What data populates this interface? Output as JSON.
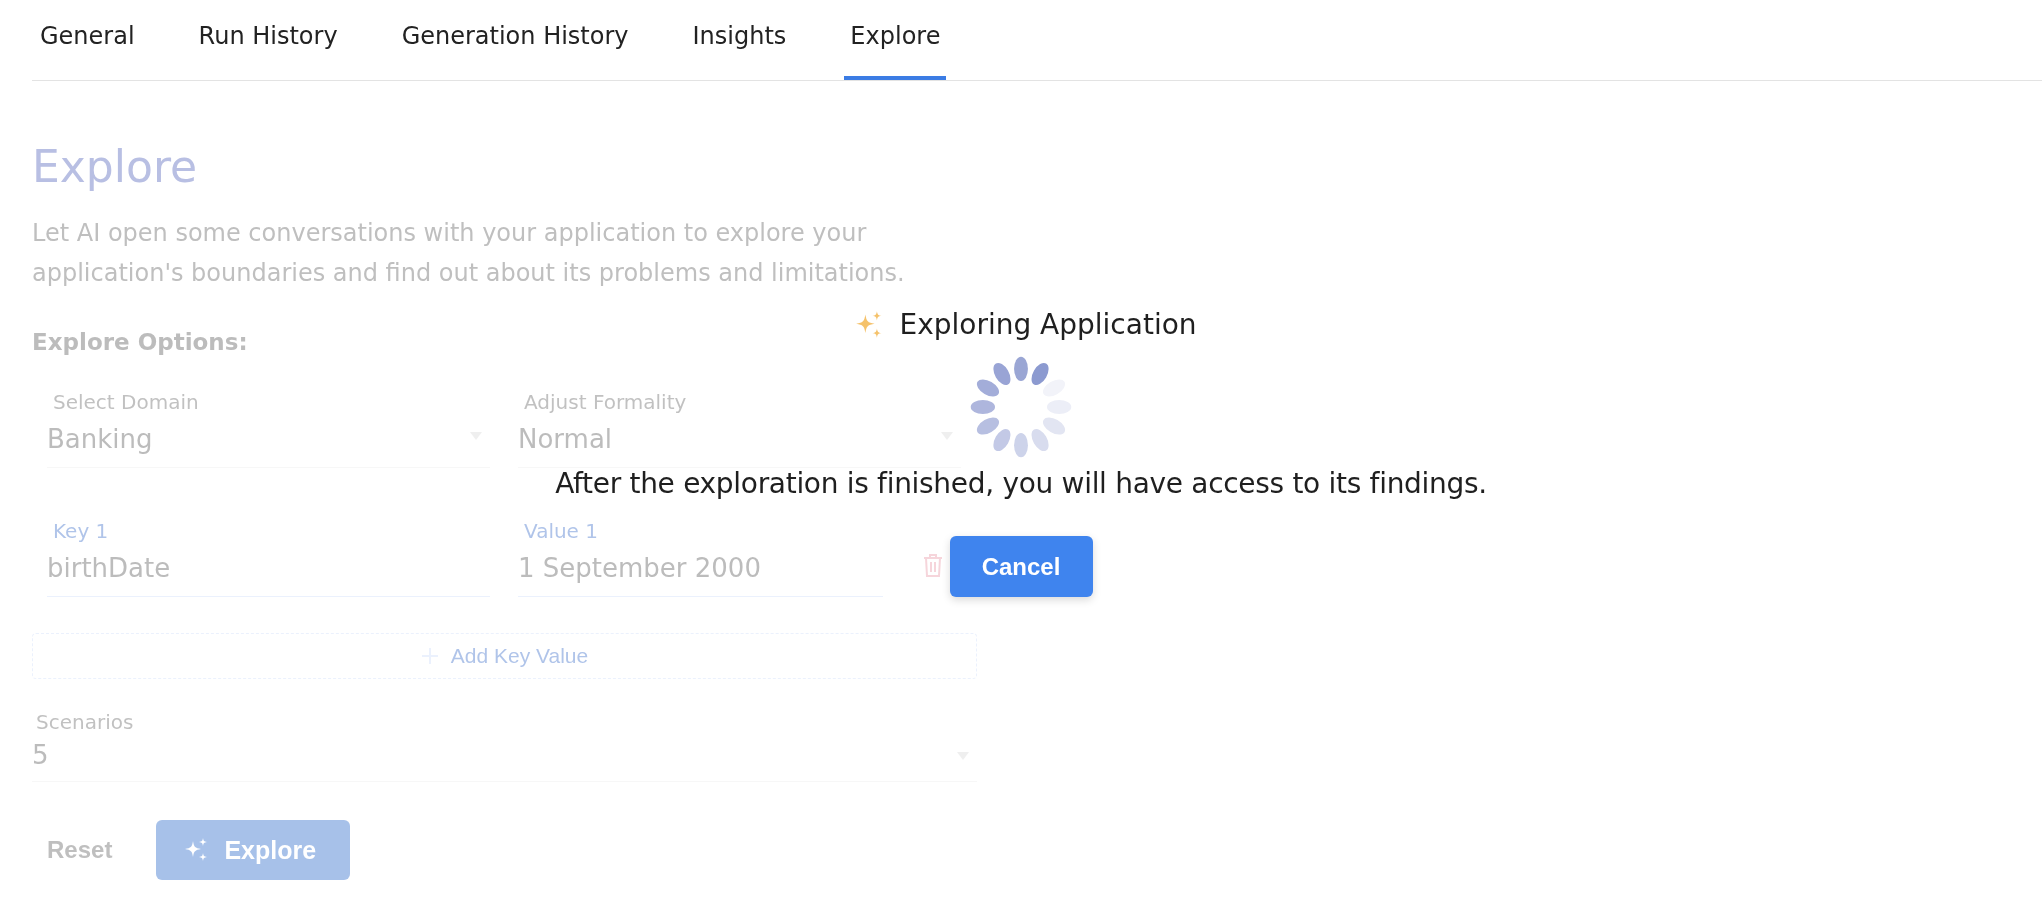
{
  "tabs": [
    {
      "label": "General",
      "selected": false
    },
    {
      "label": "Run History",
      "selected": false
    },
    {
      "label": "Generation History",
      "selected": false
    },
    {
      "label": "Insights",
      "selected": false
    },
    {
      "label": "Explore",
      "selected": true
    }
  ],
  "page": {
    "title": "Explore",
    "description_lines": [
      "Let AI open some conversations with your application to explore your",
      "application's boundaries and find out about its problems and limitations."
    ],
    "options_heading": "Explore Options:",
    "selects": [
      {
        "label": "Select Domain",
        "value": "Banking"
      },
      {
        "label": "Adjust Formality",
        "value": "Normal"
      }
    ],
    "key_values": [
      {
        "key_label": "Key 1",
        "key": "birthDate",
        "value_label": "Value 1",
        "value": "1 September 2000"
      }
    ],
    "add_button": "Add Key Value",
    "scenarios": {
      "label": "Scenarios",
      "value": "5"
    },
    "reset_button": "Reset",
    "explore_button": "Explore"
  },
  "overlay": {
    "title": "Exploring Application",
    "message": "After the exploration is finished, you will have access to its findings.",
    "cancel_button": "Cancel"
  }
}
